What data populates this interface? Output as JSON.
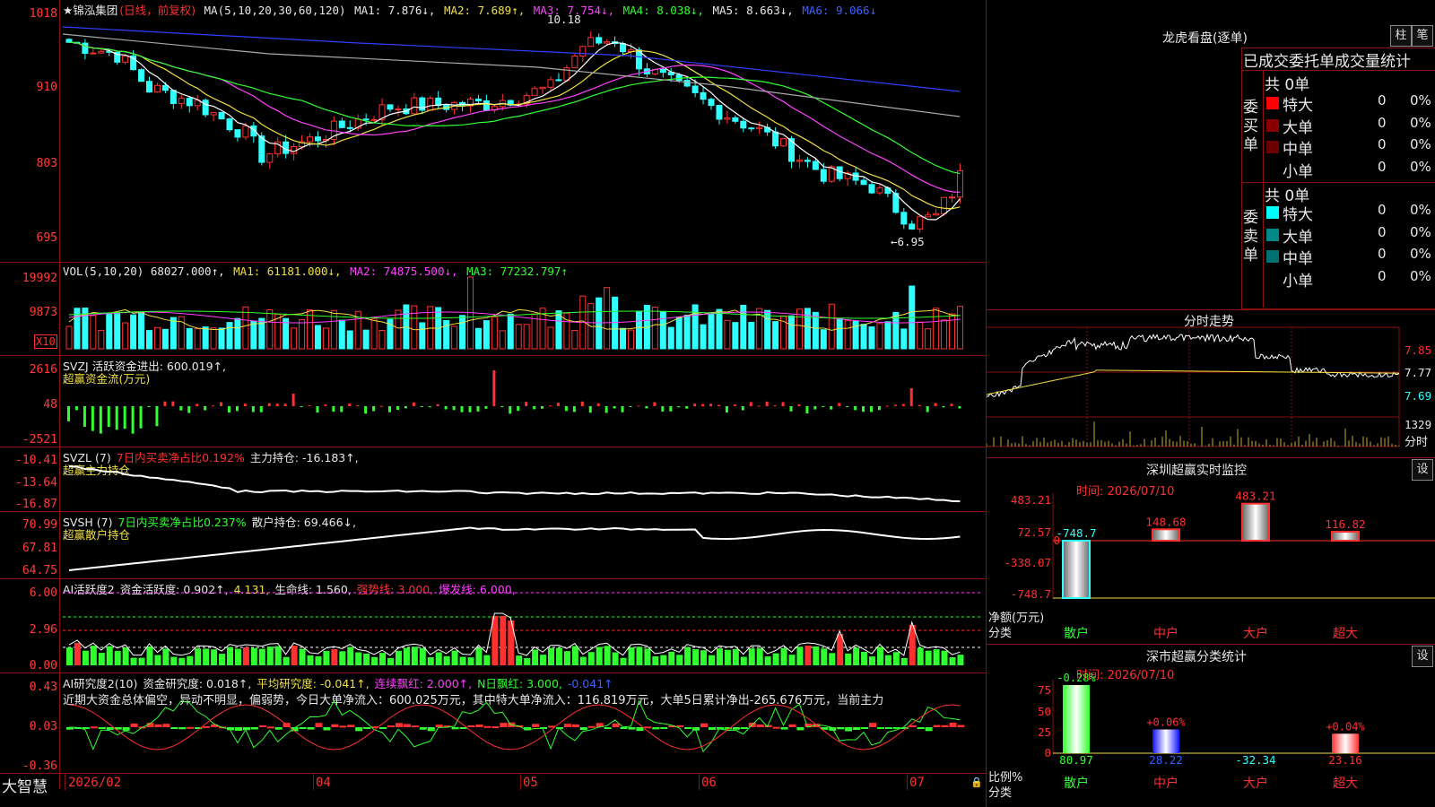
{
  "stock": {
    "name": "★锦泓集团",
    "period": "(日线，前复权)"
  },
  "price_panel": {
    "axis": [
      "1018",
      "910",
      "803",
      "695"
    ],
    "ma_header": "MA(5,10,20,30,60,120)",
    "ma1": "MA1: 7.876↓,",
    "ma2": "MA2: 7.689↑,",
    "ma3": "MA3: 7.754↓,",
    "ma4": "MA4: 8.038↓,",
    "ma5": "MA5: 8.663↓,",
    "ma6": "MA6: 9.066↓",
    "high_label": "10.18",
    "low_label": "←6.95"
  },
  "vol_panel": {
    "axis": [
      "19992",
      "9873"
    ],
    "unit": "X10",
    "header": "VOL(5,10,20) 68027.000↑,",
    "ma1": "MA1: 61181.000↓,",
    "ma2": "MA2: 74875.500↓,",
    "ma3": "MA3: 77232.797↑"
  },
  "svzj_panel": {
    "axis": [
      "2616",
      "48",
      "-2521"
    ],
    "header": "SVZJ  活跃资金进出: 600.019↑,",
    "sub": "超赢资金流(万元)"
  },
  "svzl_panel": {
    "axis": [
      "-10.41",
      "-13.64",
      "-16.87"
    ],
    "name": "SVZL (7)",
    "ratio": "7日内买卖净占比0.192%",
    "hold": "主力持仓: -16.183↑,",
    "sub": "超赢主力持仓"
  },
  "svsh_panel": {
    "axis": [
      "70.99",
      "67.81",
      "64.75"
    ],
    "name": "SVSH (7)",
    "ratio": "7日内买卖净占比0.237%",
    "hold": "散户持仓: 69.466↓,",
    "sub": "超赢散户持仓"
  },
  "ai_active_panel": {
    "axis": [
      "6.00",
      "2.96",
      "0.00"
    ],
    "name": "AI活跃度2",
    "active": "资金活跃度: 0.902↑,",
    "v2": "4.131,",
    "life": "生命线: 1.560,",
    "strong": "强势线: 3.000,",
    "burst": "爆发线: 6.000,"
  },
  "ai_research_panel": {
    "axis": [
      "0.43",
      "0.03",
      "-0.36"
    ],
    "name": "AI研究度2(10)",
    "research": "资金研究度: 0.018↑,",
    "avg": "平均研究度: -0.041↑,",
    "red": "连续飘红: 2.000↑,",
    "nred": "N日飘红: 3.000,",
    "last": "-0.041↑",
    "summary": "近期大资金总体偏空，异动不明显，偏弱势，今日大单净流入：600.025万元，其中特大单净流入：116.819万元，大单5日累计净出-265.676万元，当前主力"
  },
  "date_axis": [
    "2026/02",
    "04",
    "05",
    "06",
    "07"
  ],
  "brand": "大智慧",
  "lhb": {
    "title": "龙虎看盘(逐单)",
    "btn_bar": "柱",
    "btn_bi": "笔",
    "tabs": "已成交委托单成交量统计",
    "buy_label": "委买单",
    "sell_label": "委卖单",
    "buy_total": "共 0单",
    "sell_total": "共 0单",
    "buy_rows": [
      {
        "name": "特大",
        "count": "0",
        "pct": "0%"
      },
      {
        "name": "大单",
        "count": "0",
        "pct": "0%"
      },
      {
        "name": "中单",
        "count": "0",
        "pct": "0%"
      },
      {
        "name": "小单",
        "count": "0",
        "pct": "0%"
      }
    ],
    "sell_rows": [
      {
        "name": "特大",
        "count": "0",
        "pct": "0%"
      },
      {
        "name": "大单",
        "count": "0",
        "pct": "0%"
      },
      {
        "name": "中单",
        "count": "0",
        "pct": "0%"
      },
      {
        "name": "小单",
        "count": "0",
        "pct": "0%"
      }
    ],
    "colors": {
      "buy": [
        "#ff0000",
        "#8a0000",
        "#6a0000",
        "#000000"
      ],
      "sell": [
        "#00ffff",
        "#008888",
        "#007070",
        "#000000"
      ]
    }
  },
  "intraday": {
    "title": "分时走势",
    "axis": [
      "7.85",
      "7.77",
      "7.69"
    ],
    "vol_label": "1329",
    "sub": "分时"
  },
  "sz_monitor": {
    "title": "深圳超赢实时监控",
    "btn": "设",
    "time": "时间: 2026/07/10",
    "axis": [
      "483.21",
      "72.57",
      "-338.07",
      "-748.7"
    ],
    "axis_zero": "0",
    "unit_label": "净额(万元)",
    "cat_label": "分类",
    "categories": [
      "散户",
      "中户",
      "大户",
      "超大"
    ],
    "values": [
      "-748.7",
      "148.68",
      "483.21",
      "116.82"
    ]
  },
  "sz_stat": {
    "title": "深市超赢分类统计",
    "btn": "设",
    "time": "时间: 2026/07/10",
    "axis": [
      "75",
      "50",
      "25",
      "0"
    ],
    "unit_label": "比例%",
    "cat_label": "分类",
    "categories": [
      "散户",
      "中户",
      "大户",
      "超大"
    ],
    "top_labels": [
      "-0.28%",
      "+0.06%",
      "",
      "+0.04%"
    ],
    "bottom_labels": [
      "80.97",
      "28.22",
      "-32.34",
      "23.16"
    ]
  }
}
